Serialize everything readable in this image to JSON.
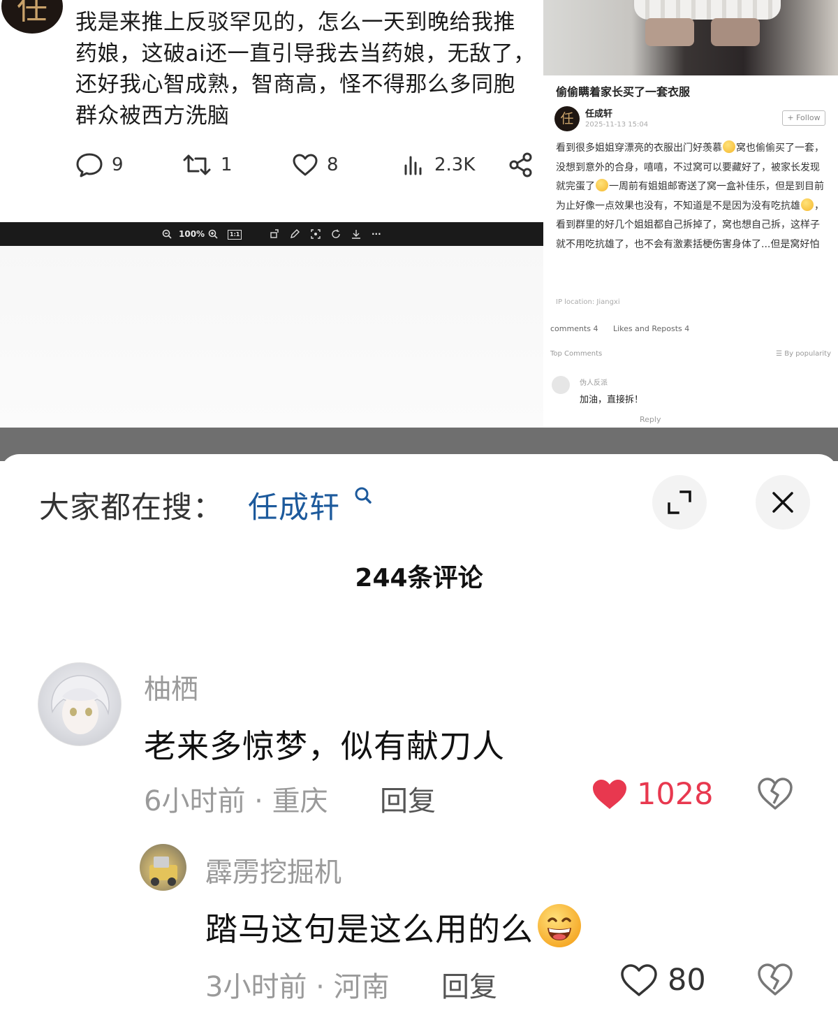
{
  "screenshot": {
    "left_post": {
      "avatar_char": "任",
      "text": "我是来推上反驳罕见的，怎么一天到晚给我推药娘，这破ai还一直引导我去当药娘，无敌了，还好我心智成熟，智商高，怪不得那么多同胞群众被西方洗脑",
      "replies": "9",
      "reposts": "1",
      "likes": "8",
      "views": "2.3K"
    },
    "viewer_bar": {
      "zoom": "100%",
      "fit_label": "1:1",
      "more": "···"
    },
    "right_post": {
      "title": "偷偷瞒着家长买了一套衣服",
      "avatar_char": "任",
      "author": "任成轩",
      "date": "2025-11-13 15:04",
      "follow": "+ Follow",
      "body_1": "看到很多姐姐穿漂亮的衣服出门好羡慕",
      "body_2": "窝也偷偷买了一套，没想到意外的合身，嘻嘻，不过窝可以要藏好了，被家长发现就完蛋了",
      "body_3": "一周前有姐姐邮寄送了窝一盒补佳乐，但是到目前为止好像一点效果也没有，不知道是不是因为没有吃抗雄",
      "body_4": "，看到群里的好几个姐姐都自己拆掉了，窝也想自己拆，这样子就不用吃抗雄了，也不会有激素括梗伤害身体了...但是窝好怕",
      "ip": "IP location: Jiangxi",
      "tab_comments": "comments 4",
      "tab_likes": "Likes and Reposts 4",
      "top_comments": "Top Comments",
      "sort": "☰ By popularity",
      "comment_user": "伪人反派",
      "comment_text": "加油，直接拆！",
      "comment_reply": "Reply"
    }
  },
  "sheet": {
    "search_label": "大家都在搜：",
    "search_term": "任成轩",
    "comment_count": "244条评论",
    "comments": [
      {
        "user": "柚栖",
        "text": "老来多惊梦，似有献刀人",
        "meta": "6小时前 · 重庆",
        "reply": "回复",
        "likes": "1028",
        "liked": true
      },
      {
        "user": "霹雳挖掘机",
        "text": "踏马这句是这么用的么",
        "meta": "3小时前 · 河南",
        "reply": "回复",
        "likes": "80",
        "liked": false
      }
    ]
  },
  "colors": {
    "search_term": "#1d5a9c",
    "liked_heart": "#e8384f",
    "muted_text": "#9a9a9a"
  },
  "icons": [
    "comment-icon",
    "repost-icon",
    "heart-icon",
    "views-icon",
    "share-icon",
    "search-icon",
    "expand-icon",
    "close-icon",
    "dislike-icon",
    "grin-emoji"
  ]
}
